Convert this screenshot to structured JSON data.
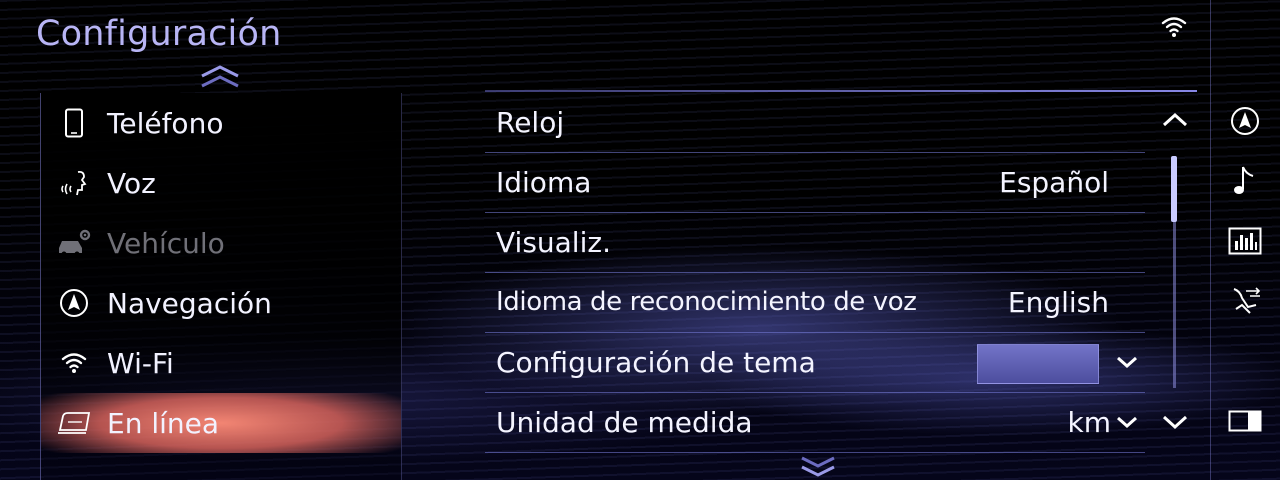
{
  "header": {
    "title": "Configuración"
  },
  "menu": {
    "items": [
      {
        "label": "Teléfono",
        "icon": "phone-icon",
        "state": "normal"
      },
      {
        "label": "Voz",
        "icon": "voice-icon",
        "state": "normal"
      },
      {
        "label": "Vehículo",
        "icon": "vehicle-settings-icon",
        "state": "disabled"
      },
      {
        "label": "Navegación",
        "icon": "navigation-icon",
        "state": "normal"
      },
      {
        "label": "Wi-Fi",
        "icon": "wifi-icon",
        "state": "normal"
      },
      {
        "label": "En línea",
        "icon": "online-icon",
        "state": "selected"
      }
    ]
  },
  "settings": {
    "rows": [
      {
        "label": "Reloj",
        "value": ""
      },
      {
        "label": "Idioma",
        "value": "Español"
      },
      {
        "label": "Visualiz.",
        "value": ""
      },
      {
        "label": "Idioma de reconocimiento de voz",
        "value": "English"
      },
      {
        "label": "Configuración de tema",
        "value": ""
      },
      {
        "label": "Unidad de medida",
        "value": "km"
      }
    ],
    "theme_color": "#5f60b4"
  },
  "sidebar": {
    "shortcuts": [
      "navigation-icon",
      "music-note-icon",
      "audio-equalizer-icon",
      "climate-icon",
      "split-screen-icon"
    ]
  },
  "colors": {
    "title": "#b8b5f5",
    "accent_selected": "#f08a78",
    "divider": "#787cdc"
  }
}
